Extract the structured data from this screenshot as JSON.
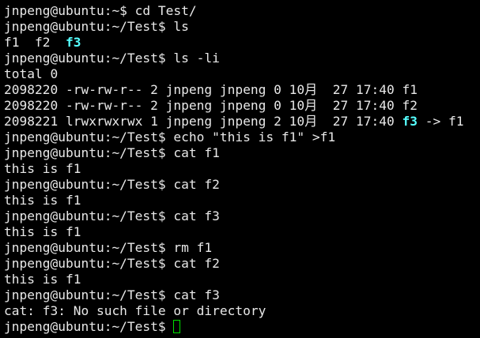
{
  "terminal": {
    "lines": [
      [
        {
          "t": "jnpeng@ubuntu:~$ cd Test/"
        }
      ],
      [
        {
          "t": "jnpeng@ubuntu:~/Test$ ls"
        }
      ],
      [
        {
          "t": "f1  f2  "
        },
        {
          "t": "f3",
          "link": true
        }
      ],
      [
        {
          "t": "jnpeng@ubuntu:~/Test$ ls -li"
        }
      ],
      [
        {
          "t": "total 0"
        }
      ],
      [
        {
          "t": "2098220 -rw-rw-r-- 2 jnpeng jnpeng 0 10月  27 17:40 f1"
        }
      ],
      [
        {
          "t": "2098220 -rw-rw-r-- 2 jnpeng jnpeng 0 10月  27 17:40 f2"
        }
      ],
      [
        {
          "t": "2098221 lrwxrwxrwx 1 jnpeng jnpeng 2 10月  27 17:40 "
        },
        {
          "t": "f3",
          "link": true
        },
        {
          "t": " -> f1"
        }
      ],
      [
        {
          "t": "jnpeng@ubuntu:~/Test$ echo \"this is f1\" >f1"
        }
      ],
      [
        {
          "t": "jnpeng@ubuntu:~/Test$ cat f1"
        }
      ],
      [
        {
          "t": "this is f1"
        }
      ],
      [
        {
          "t": "jnpeng@ubuntu:~/Test$ cat f2"
        }
      ],
      [
        {
          "t": "this is f1"
        }
      ],
      [
        {
          "t": "jnpeng@ubuntu:~/Test$ cat f3"
        }
      ],
      [
        {
          "t": "this is f1"
        }
      ],
      [
        {
          "t": "jnpeng@ubuntu:~/Test$ rm f1"
        }
      ],
      [
        {
          "t": "jnpeng@ubuntu:~/Test$ cat f2"
        }
      ],
      [
        {
          "t": "this is f1"
        }
      ],
      [
        {
          "t": "jnpeng@ubuntu:~/Test$ cat f3"
        }
      ],
      [
        {
          "t": "cat: f3: No such file or directory"
        }
      ]
    ],
    "prompt": "jnpeng@ubuntu:~/Test$ ",
    "colors": {
      "background": "#000000",
      "text": "#e8e8e8",
      "symlink": "#55ffff",
      "cursor": "#00e000"
    }
  }
}
